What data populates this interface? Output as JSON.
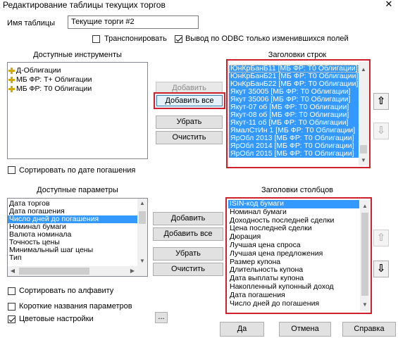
{
  "window": {
    "title": "Редактирование таблицы текущих торгов",
    "close_glyph": "✕"
  },
  "table_name": {
    "label": "Имя таблицы",
    "value": "Текущие торги #2"
  },
  "options": {
    "transpose_label": "Транспонировать",
    "transpose_checked": false,
    "odbc_label": "Вывод по ODBC только изменившихся  полей",
    "odbc_checked": true
  },
  "available_instruments": {
    "header": "Доступные инструменты",
    "items": [
      "Д-Облигации",
      "МБ ФР: Т+ Облигации",
      "МБ ФР: Т0 Облигации"
    ]
  },
  "sort_by_maturity": {
    "label": "Сортировать по дате погашения",
    "checked": false
  },
  "row_buttons": {
    "add": "Добавить",
    "add_all": "Добавить все",
    "remove": "Убрать",
    "clear": "Очистить"
  },
  "row_headers": {
    "header": "Заголовки строк",
    "items": [
      "ЮнКрБанБ11 [МБ ФР: Т0 Облигации]",
      "ЮнКрБанБ21 [МБ ФР: Т0 Облигации]",
      "ЮнКрБанБ22 [МБ ФР: Т0 Облигации]",
      "Якут 35005 [МБ ФР: Т0 Облигации]",
      "Якут 35006 [МБ ФР: Т0 Облигации]",
      "Якут-07 об [МБ ФР: Т0 Облигации]",
      "Якут-08 об [МБ ФР: Т0 Облигации]",
      "Якут-11 об [МБ ФР: Т0 Облигации]",
      "ЯмалСтИн 1 [МБ ФР: Т0 Облигации]",
      "ЯрОбл 2013 [МБ ФР: Т0 Облигации]",
      "ЯрОбл 2014 [МБ ФР: Т0 Облигации]",
      "ЯрОбл 2015 [МБ ФР: Т0 Облигации]"
    ]
  },
  "available_params": {
    "header": "Доступные параметры",
    "items": [
      "Дата торгов",
      "Дата погашения",
      "Число дней до погашения",
      "Номинал бумаги",
      "Валюта номинала",
      "Точность цены",
      "Минимальный шаг цены",
      "Тип"
    ],
    "selected_index": 2
  },
  "param_buttons": {
    "add": "Добавить",
    "add_all": "Добавить все",
    "remove": "Убрать",
    "clear": "Очистить"
  },
  "column_headers": {
    "header": "Заголовки столбцов",
    "items": [
      "ISIN-код бумаги",
      "Номинал бумаги",
      "Доходность последней сделки",
      "Цена последней сделки",
      "Дюрация",
      "Лучшая цена спроса",
      "Лучшая цена предложения",
      "Размер купона",
      "Длительность купона",
      "Дата выплаты купона",
      "Накопленный купонный доход",
      "Дата погашения",
      "Число дней до погашения"
    ],
    "selected_index": 0
  },
  "bottom_options": {
    "sort_alpha_label": "Сортировать по алфавиту",
    "sort_alpha_checked": false,
    "short_names_label": "Короткие названия параметров",
    "short_names_checked": false,
    "color_settings_label": "Цветовые настройки",
    "color_settings_checked": true,
    "more_label": "..."
  },
  "footer": {
    "ok": "Да",
    "cancel": "Отмена",
    "help": "Справка"
  },
  "colors": {
    "selection": "#3399ff",
    "highlight_border": "#d0202b"
  }
}
